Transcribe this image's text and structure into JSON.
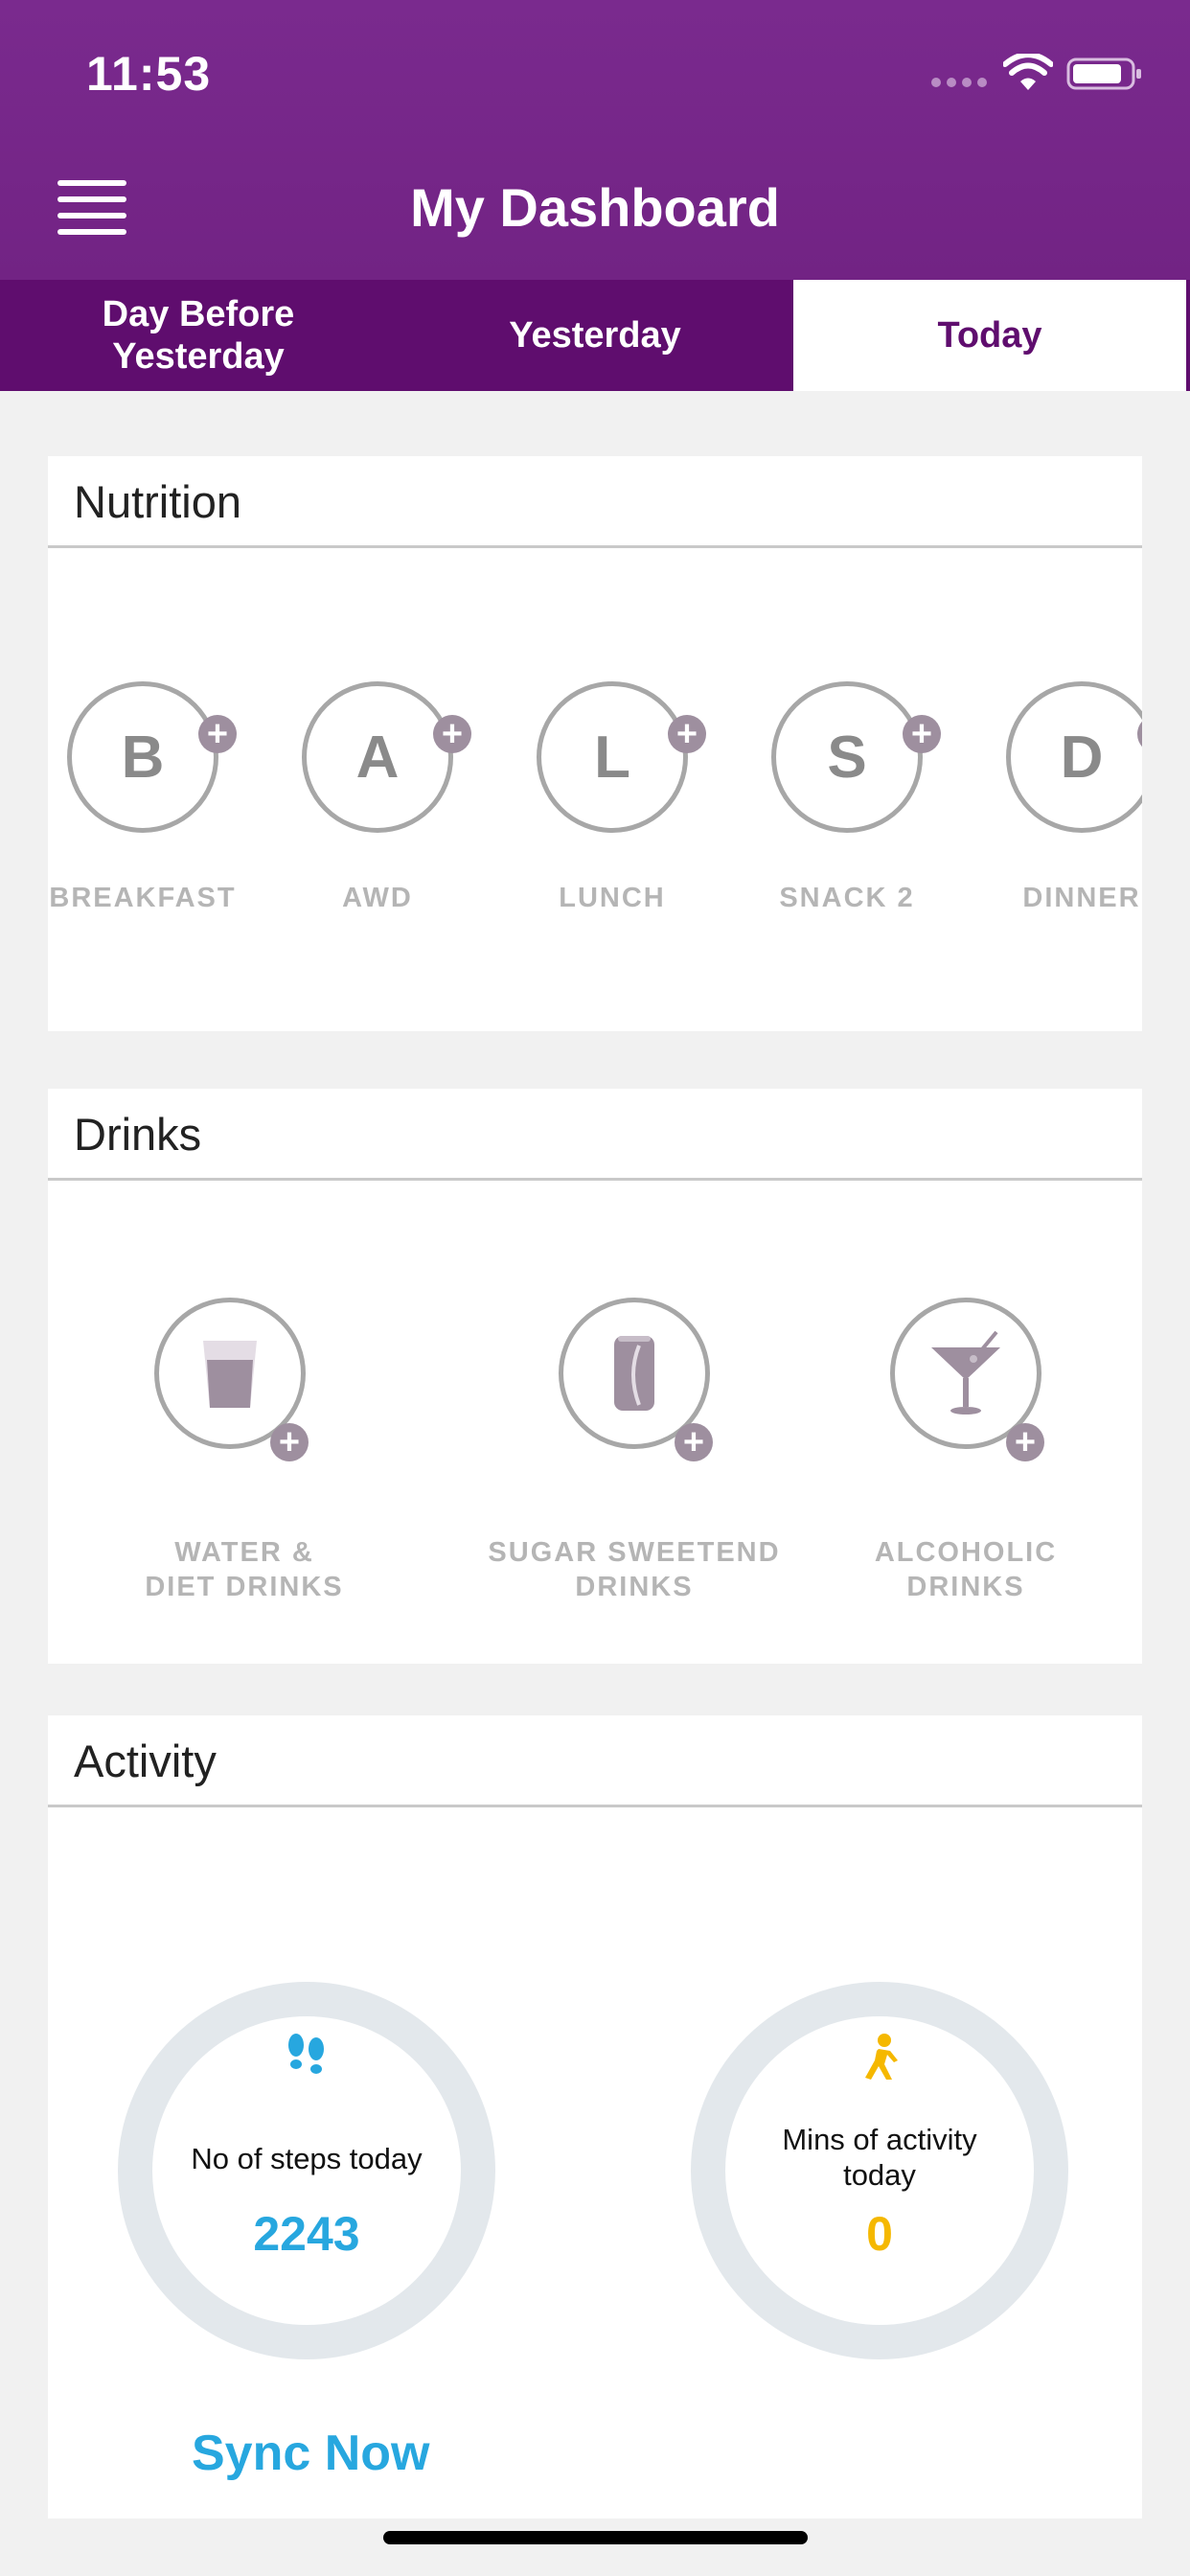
{
  "status_bar": {
    "time": "11:53"
  },
  "header": {
    "title": "My Dashboard",
    "menu_icon": "hamburger-menu-icon"
  },
  "tabs": [
    {
      "label": "Day Before Yesterday",
      "active": false
    },
    {
      "label": "Yesterday",
      "active": false
    },
    {
      "label": "Today",
      "active": true
    }
  ],
  "nutrition": {
    "title": "Nutrition",
    "meals": [
      {
        "letter": "B",
        "label": "BREAKFAST"
      },
      {
        "letter": "A",
        "label": "AWD"
      },
      {
        "letter": "L",
        "label": "LUNCH"
      },
      {
        "letter": "S",
        "label": "SNACK 2"
      },
      {
        "letter": "D",
        "label": "DINNER"
      }
    ]
  },
  "drinks": {
    "title": "Drinks",
    "items": [
      {
        "label_line1": "WATER &",
        "label_line2": "DIET DRINKS",
        "icon": "glass-icon"
      },
      {
        "label_line1": "SUGAR SWEETEND",
        "label_line2": "DRINKS",
        "icon": "soda-can-icon"
      },
      {
        "label_line1": "ALCOHOLIC",
        "label_line2": "DRINKS",
        "icon": "cocktail-icon"
      }
    ]
  },
  "activity": {
    "title": "Activity",
    "steps": {
      "label": "No of steps today",
      "value": "2243",
      "color": "#27a7df",
      "icon": "footprints-icon"
    },
    "minutes": {
      "label_line1": "Mins of activity",
      "label_line2": "today",
      "value": "0",
      "color": "#f5b800",
      "icon": "running-person-icon"
    },
    "sync_label": "Sync Now"
  },
  "colors": {
    "header_purple": "#75268a",
    "tab_purple": "#5f0d6e",
    "badge": "#9e8f9f",
    "steps_blue": "#27a7df",
    "activity_yellow": "#f5b800"
  }
}
